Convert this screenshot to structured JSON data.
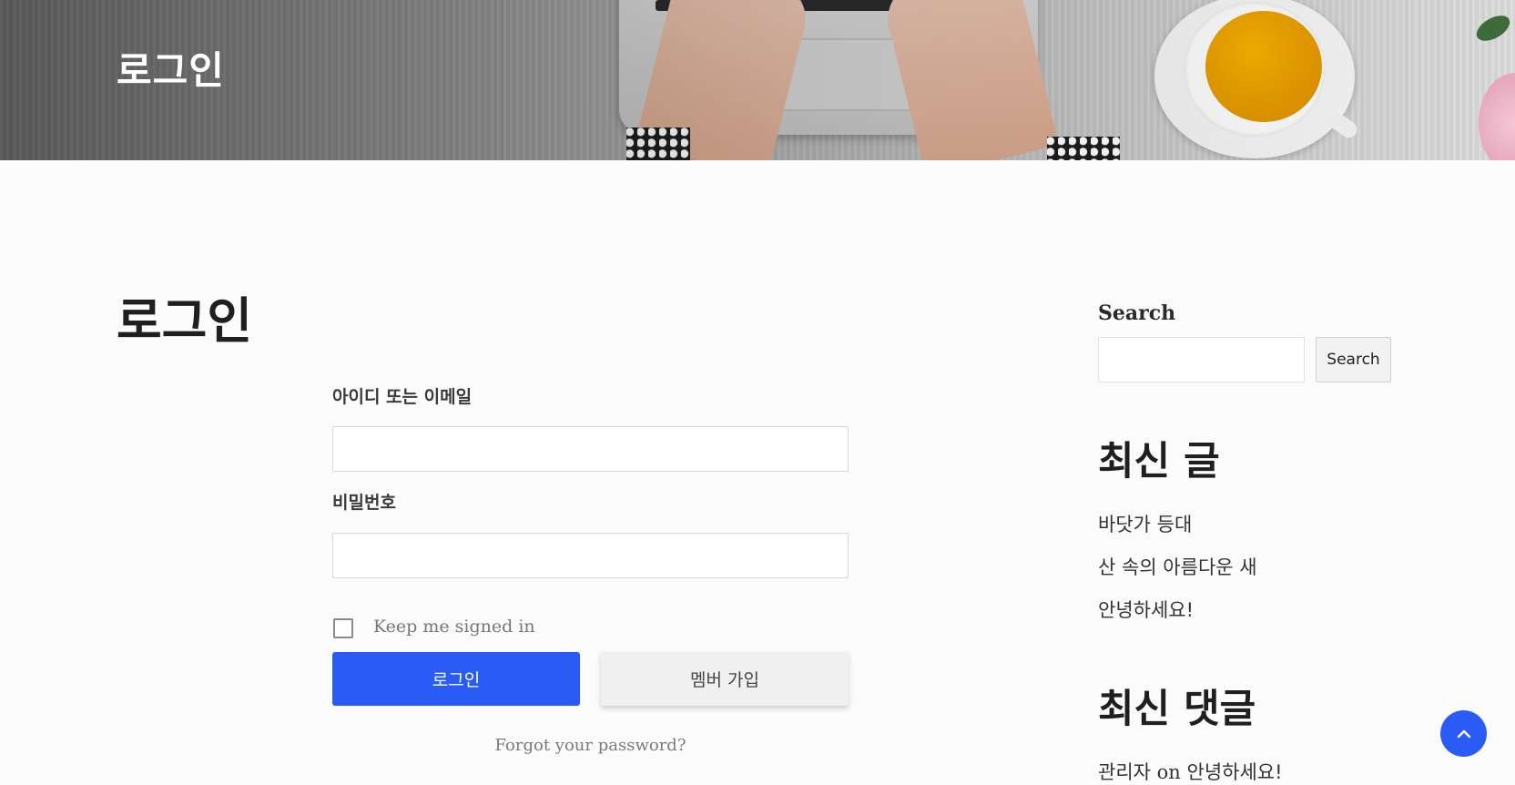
{
  "hero": {
    "title": "로그인"
  },
  "main": {
    "page_title": "로그인",
    "username_label": "아이디 또는 이메일",
    "username_value": "",
    "password_label": "비밀번호",
    "password_value": "",
    "remember_label": "Keep me signed in",
    "remember_checked": false,
    "login_button": "로그인",
    "register_button": "멤버 가입",
    "forgot_link": "Forgot your password?"
  },
  "sidebar": {
    "search_title": "Search",
    "search_value": "",
    "search_button": "Search",
    "recent_posts_title": "최신 글",
    "recent_posts": [
      "바닷가 등대",
      "산 속의 아름다운 새",
      "안녕하세요!"
    ],
    "recent_comments_title": "최신 댓글",
    "recent_comment": {
      "author": "관리자",
      "connector": "on",
      "post": "안녕하세요!"
    }
  },
  "scroll_top": {
    "icon": "chevron-up-icon"
  },
  "colors": {
    "accent": "#2a5cf5",
    "background": "#fbfbfb",
    "hero_text": "#ffffff"
  }
}
